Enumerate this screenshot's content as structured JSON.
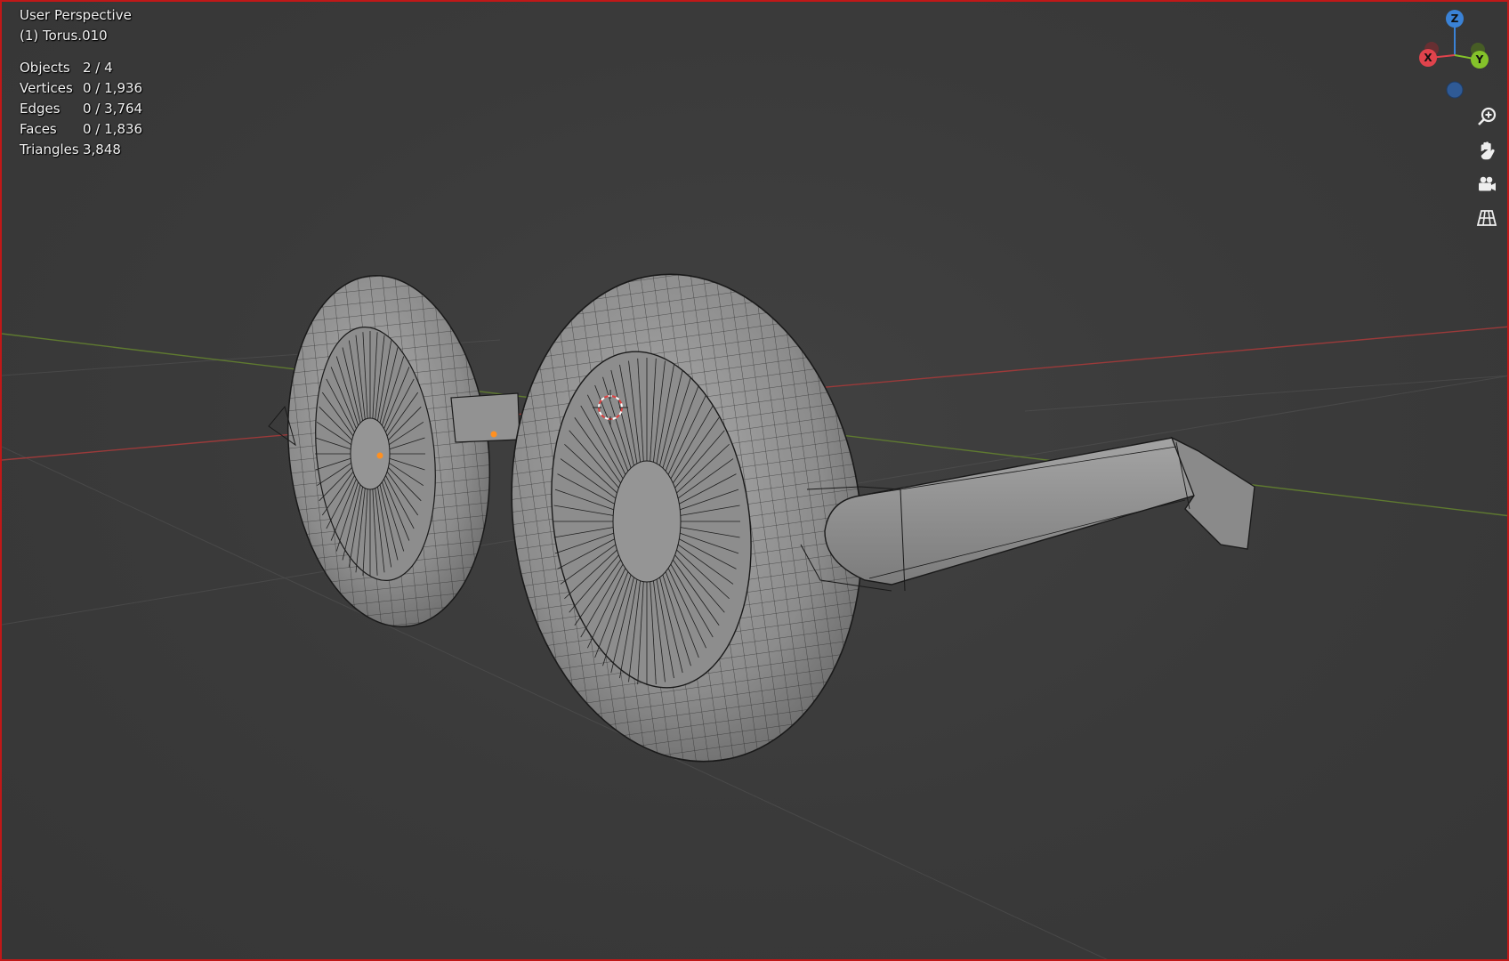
{
  "viewport": {
    "view_name": "User Perspective",
    "active_object": "(1) Torus.010"
  },
  "stats": [
    {
      "label": "Objects",
      "value": "2 / 4"
    },
    {
      "label": "Vertices",
      "value": "0 / 1,936"
    },
    {
      "label": "Edges",
      "value": "0 / 3,764"
    },
    {
      "label": "Faces",
      "value": "0 / 1,836"
    },
    {
      "label": "Triangles",
      "value": "3,848"
    }
  ],
  "gizmo": {
    "z_label": "Z",
    "x_label": "X",
    "y_label": "Y",
    "colors": {
      "x": "#e0434c",
      "y": "#84c22a",
      "z": "#3a82d6"
    }
  },
  "nav_buttons": [
    {
      "name": "zoom-icon"
    },
    {
      "name": "pan-hand-icon"
    },
    {
      "name": "camera-icon"
    },
    {
      "name": "perspective-grid-icon"
    }
  ],
  "colors": {
    "background": "#3b3b3b",
    "border": "#c01818",
    "mesh": "#8e8e8e",
    "wire": "#1a1a1a",
    "x_axis_line": "#9b3a3a",
    "y_axis_line": "#5f7a30"
  }
}
